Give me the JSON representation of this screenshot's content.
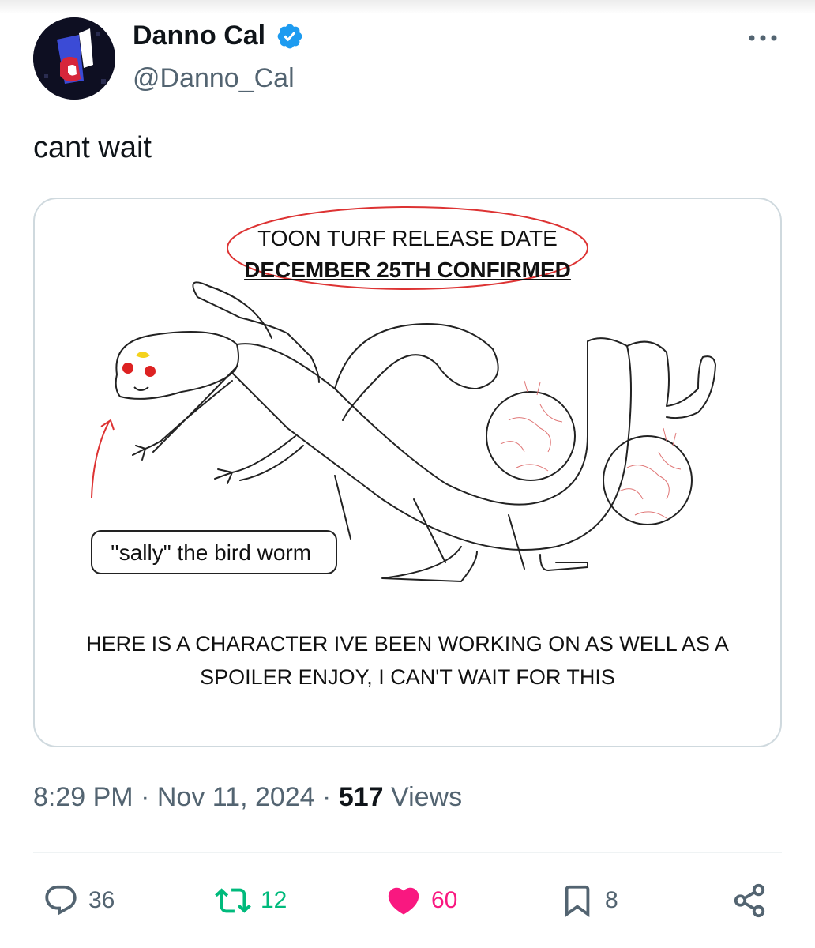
{
  "author": {
    "display_name": "Danno Cal",
    "handle": "@Danno_Cal",
    "verified": true
  },
  "tweet": {
    "text": "cant wait"
  },
  "media_image": {
    "title_line1": "TOON TURF RELEASE DATE",
    "title_line2": "DECEMBER 25TH CONFIRMED",
    "character_label": "''sally\" the bird worm",
    "caption_line1": "HERE IS A CHARACTER IVE BEEN WORKING ON AS WELL AS A",
    "caption_line2": "SPOILER ENJOY, I CAN'T WAIT FOR THIS"
  },
  "meta": {
    "time": "8:29 PM",
    "separator": "·",
    "date": "Nov 11, 2024",
    "views_count": "517",
    "views_label": "Views"
  },
  "actions": {
    "replies": "36",
    "retweets": "12",
    "likes": "60",
    "bookmarks": "8"
  },
  "colors": {
    "accent_blue": "#1d9bf0",
    "retweet_green": "#00ba7c",
    "like_pink": "#f91880",
    "secondary_text": "#536471"
  },
  "icons": [
    "verified-badge-icon",
    "more-icon",
    "reply-icon",
    "retweet-icon",
    "like-icon",
    "bookmark-icon",
    "share-icon"
  ]
}
